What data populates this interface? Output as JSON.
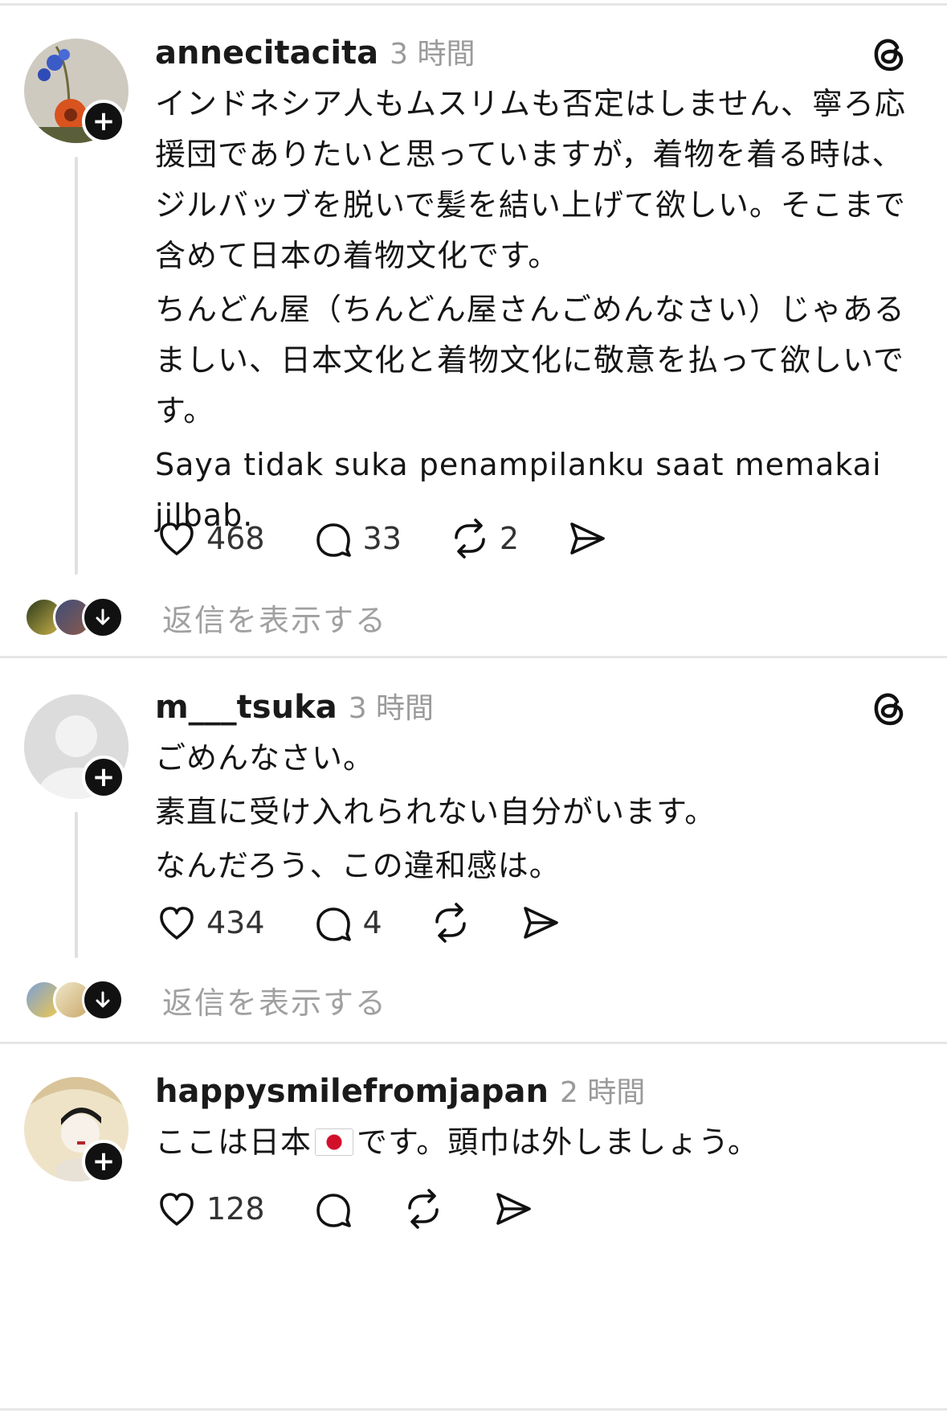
{
  "posts": [
    {
      "username": "annecitacita",
      "time": "3 時間",
      "paragraphs": [
        "インドネシア人もムスリムも否定はしません、寧ろ応援団でありたいと思っていますが，着物を着る時は、ジルバッブを脱いで髪を結い上げて欲しい。そこまで含めて日本の着物文化です。",
        "ちんどん屋（ちんどん屋さんごめんなさい）じゃあるましい、日本文化と着物文化に敬意を払って欲しいです。",
        "Saya tidak suka penampilanku saat memakai jilbab."
      ],
      "likes": "468",
      "comments": "33",
      "reposts": "2",
      "show_replies": "返信を表示する"
    },
    {
      "username": "m___tsuka",
      "time": "3 時間",
      "paragraphs": [
        "ごめんなさい。",
        "素直に受け入れられない自分がいます。",
        "なんだろう、この違和感は。"
      ],
      "likes": "434",
      "comments": "4",
      "reposts": "",
      "show_replies": "返信を表示する"
    },
    {
      "username": "happysmilefromjapan",
      "time": "2 時間",
      "text_before_flag": "ここは日本",
      "flag_icon": "japan-flag-icon",
      "text_after_flag": "です。頭巾は外しましょう。",
      "likes": "128",
      "comments": "",
      "reposts": ""
    }
  ],
  "icons": {
    "like": "heart-icon",
    "comment": "comment-bubble-icon",
    "repost": "repost-icon",
    "share": "send-icon",
    "threads": "threads-logo-icon",
    "follow": "plus-icon"
  }
}
